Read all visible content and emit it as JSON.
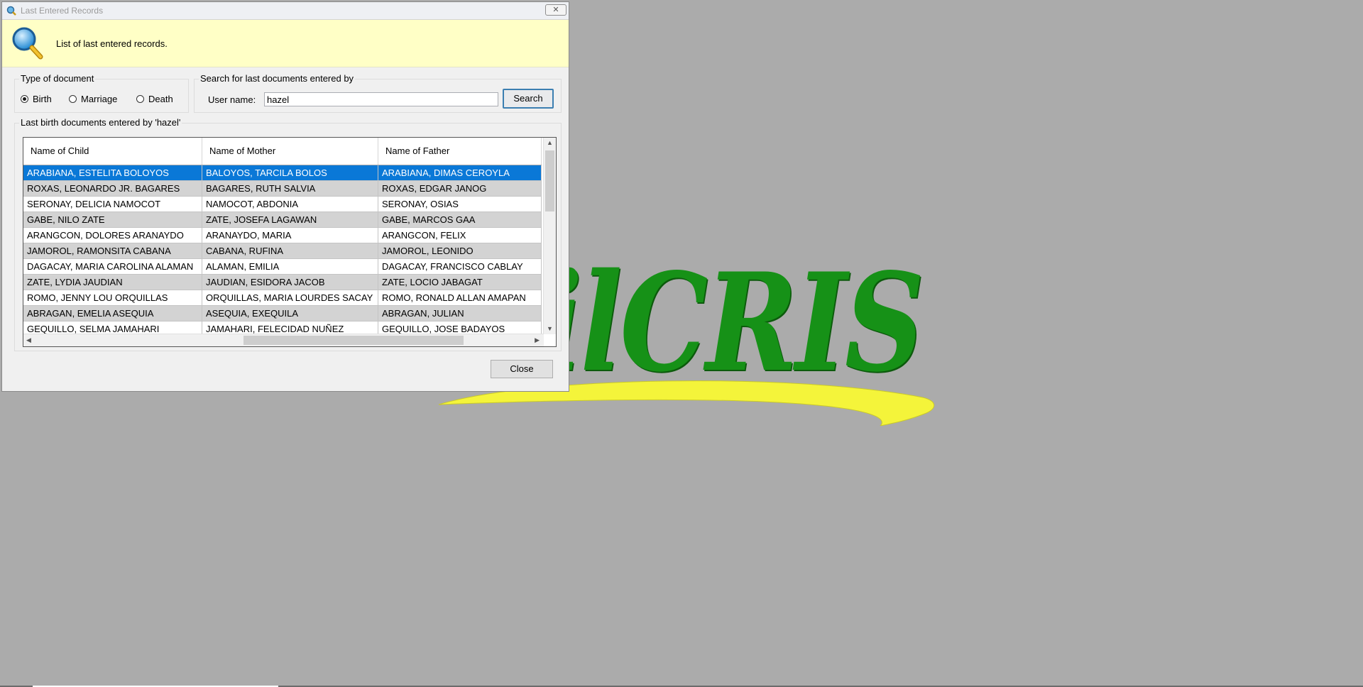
{
  "background": {
    "logo_text": "milCRIS",
    "logo_color": "#169117",
    "swoosh_color": "#ffff33"
  },
  "window": {
    "title": "Last Entered Records",
    "close_glyph": "✕"
  },
  "banner": {
    "text": "List of last entered records.",
    "icon": "magnifier-icon"
  },
  "type_group": {
    "legend": "Type of document",
    "options": [
      {
        "label": "Birth",
        "selected": true
      },
      {
        "label": "Marriage",
        "selected": false
      },
      {
        "label": "Death",
        "selected": false
      }
    ]
  },
  "search_group": {
    "legend": "Search for last documents entered by",
    "user_label": "User name:",
    "user_value": "hazel",
    "search_label": "Search"
  },
  "results": {
    "legend": "Last birth documents entered by 'hazel'",
    "columns": [
      "Name of Child",
      "Name of Mother",
      "Name of Father"
    ],
    "rows": [
      [
        "ARABIANA, ESTELITA BOLOYOS",
        "BALOYOS, TARCILA BOLOS",
        "ARABIANA, DIMAS CEROYLA"
      ],
      [
        "ROXAS, LEONARDO JR. BAGARES",
        "BAGARES, RUTH SALVIA",
        "ROXAS, EDGAR JANOG"
      ],
      [
        "SERONAY, DELICIA NAMOCOT",
        "NAMOCOT, ABDONIA",
        "SERONAY, OSIAS"
      ],
      [
        "GABE, NILO ZATE",
        "ZATE, JOSEFA LAGAWAN",
        "GABE, MARCOS GAA"
      ],
      [
        "ARANGCON, DOLORES ARANAYDO",
        "ARANAYDO, MARIA",
        "ARANGCON, FELIX"
      ],
      [
        "JAMOROL, RAMONSITA CABANA",
        "CABANA, RUFINA",
        "JAMOROL, LEONIDO"
      ],
      [
        "DAGACAY, MARIA CAROLINA ALAMAN",
        "ALAMAN, EMILIA",
        "DAGACAY, FRANCISCO CABLAY"
      ],
      [
        "ZATE, LYDIA JAUDIAN",
        "JAUDIAN, ESIDORA JACOB",
        "ZATE, LOCIO JABAGAT"
      ],
      [
        "ROMO, JENNY LOU ORQUILLAS",
        "ORQUILLAS, MARIA LOURDES SACAY",
        "ROMO, RONALD ALLAN AMAPAN"
      ],
      [
        "ABRAGAN, EMELIA ASEQUIA",
        "ASEQUIA, EXEQUILA",
        "ABRAGAN, JULIAN"
      ],
      [
        "GEQUILLO, SELMA JAMAHARI",
        "JAMAHARI, FELECIDAD NUÑEZ",
        "GEQUILLO, JOSE BADAYOS"
      ]
    ],
    "selected_row": 0,
    "selection_color": "#0a78d7"
  },
  "close_label": "Close"
}
